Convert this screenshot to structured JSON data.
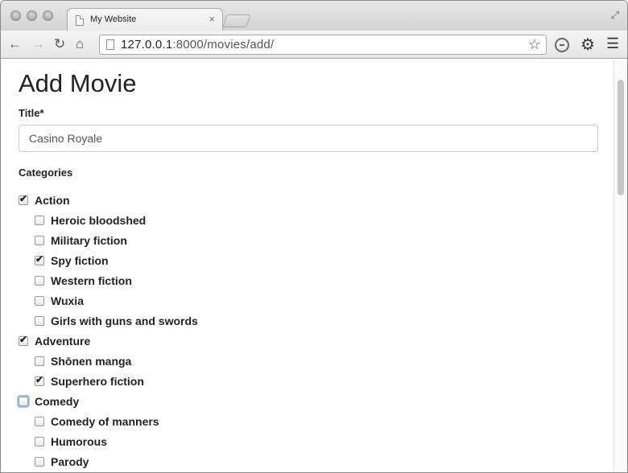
{
  "browser": {
    "tab_title": "My Website",
    "tab_close": "×",
    "url_host": "127.0.0.1",
    "url_path": ":8000/movies/add/"
  },
  "page": {
    "heading": "Add Movie",
    "title_label": "Title*",
    "title_value": "Casino Royale",
    "categories_label": "Categories"
  },
  "categories": [
    {
      "label": "Action",
      "checked": true,
      "level": 0
    },
    {
      "label": "Heroic bloodshed",
      "checked": false,
      "level": 1
    },
    {
      "label": "Military fiction",
      "checked": false,
      "level": 1
    },
    {
      "label": "Spy fiction",
      "checked": true,
      "level": 1
    },
    {
      "label": "Western fiction",
      "checked": false,
      "level": 1
    },
    {
      "label": "Wuxia",
      "checked": false,
      "level": 1
    },
    {
      "label": "Girls with guns and swords",
      "checked": false,
      "level": 1
    },
    {
      "label": "Adventure",
      "checked": true,
      "level": 0
    },
    {
      "label": "Shōnen manga",
      "checked": false,
      "level": 1
    },
    {
      "label": "Superhero fiction",
      "checked": true,
      "level": 1
    },
    {
      "label": "Comedy",
      "checked": false,
      "level": 0,
      "focused": true
    },
    {
      "label": "Comedy of manners",
      "checked": false,
      "level": 1
    },
    {
      "label": "Humorous",
      "checked": false,
      "level": 1
    },
    {
      "label": "Parody",
      "checked": false,
      "level": 1
    }
  ]
}
